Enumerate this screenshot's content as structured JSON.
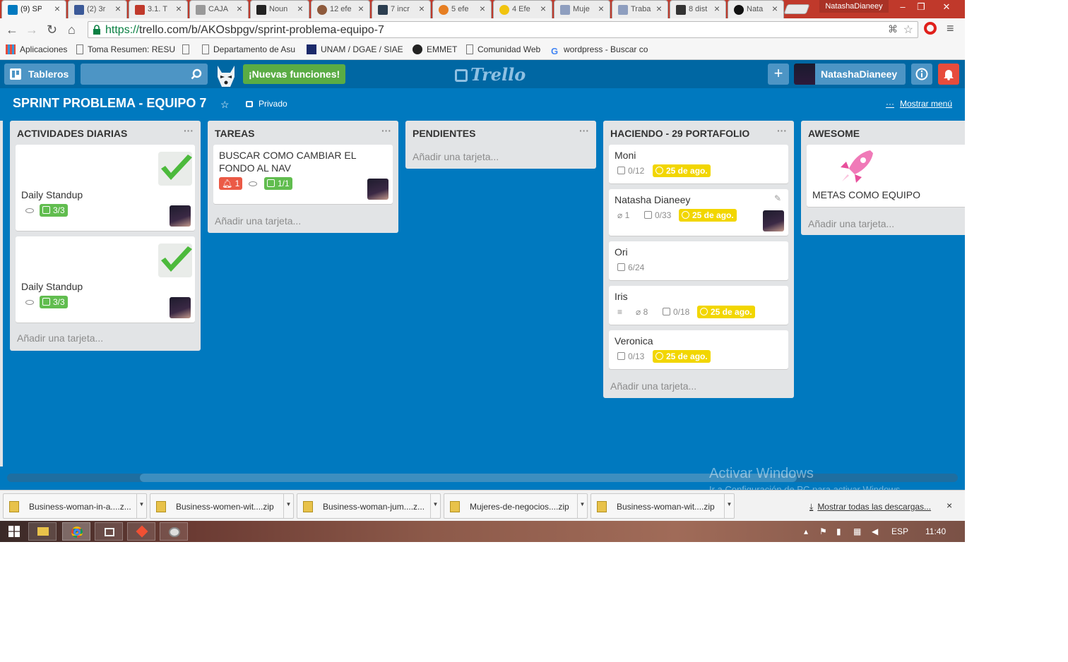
{
  "browser": {
    "tabs": [
      {
        "title": "(9) SP",
        "active": true,
        "icon": "trello-favicon"
      },
      {
        "title": "(2) 3r",
        "icon": "facebook-favicon"
      },
      {
        "title": "3.1. T",
        "icon": "book-favicon"
      },
      {
        "title": "CAJA",
        "icon": "page-favicon"
      },
      {
        "title": "Noun",
        "icon": "noun-favicon"
      },
      {
        "title": "12 efe",
        "icon": "leaf-favicon"
      },
      {
        "title": "7 incr",
        "icon": "mail-favicon"
      },
      {
        "title": "5 efe",
        "icon": "orange-favicon"
      },
      {
        "title": "4 Efe",
        "icon": "yellow-favicon"
      },
      {
        "title": "Muje",
        "icon": "image-favicon"
      },
      {
        "title": "Traba",
        "icon": "image-favicon"
      },
      {
        "title": "8 dist",
        "icon": "e-favicon"
      },
      {
        "title": "Nata",
        "icon": "github-favicon"
      }
    ],
    "window_user": "NatashaDianeey",
    "url_scheme": "https://",
    "url_rest": "trello.com/b/AKOsbpgv/sprint-problema-equipo-7",
    "bookmarks": [
      {
        "label": "Aplicaciones",
        "icon": "apps-icon"
      },
      {
        "label": "Toma Resumen: RESU",
        "icon": "page-icon"
      },
      {
        "label": "",
        "icon": "page-icon"
      },
      {
        "label": "Departamento de Asu",
        "icon": "page-icon"
      },
      {
        "label": "UNAM / DGAE / SIAE",
        "icon": "unam-icon"
      },
      {
        "label": "EMMET",
        "icon": "emmet-icon"
      },
      {
        "label": "Comunidad Web",
        "icon": "page-icon"
      },
      {
        "label": "wordpress - Buscar co",
        "icon": "google-icon"
      }
    ]
  },
  "header": {
    "boards_label": "Tableros",
    "new_features": "¡Nuevas funciones!",
    "logo": "Trello",
    "add": "+",
    "username": "NatashaDianeey",
    "info": "i",
    "notif": "🔔"
  },
  "board": {
    "title": "SPRINT PROBLEMA - EQUIPO 7",
    "privacy": "Privado",
    "show_menu": "Mostrar menú",
    "add_card": "Añadir una tarjeta...",
    "colors": {
      "background": "#0079bf",
      "green": "#61bd4f",
      "red": "#eb5a46",
      "yellow": "#f2d600"
    }
  },
  "lists": [
    {
      "title": "ACTIVIDADES DIARIAS",
      "cards": [
        {
          "title": "Daily Standup",
          "checklist": "3/3"
        },
        {
          "title": "Daily Standup",
          "checklist": "3/3"
        }
      ]
    },
    {
      "title": "TAREAS",
      "cards": [
        {
          "title": "BUSCAR COMO CAMBIAR EL FONDO AL NAV",
          "alerts": "1",
          "checklist": "1/1"
        }
      ]
    },
    {
      "title": "PENDIENTES",
      "cards": []
    },
    {
      "title": "HACIENDO - 29 PORTAFOLIO",
      "cards": [
        {
          "title": "Moni",
          "checklist": "0/12",
          "due": "25 de ago."
        },
        {
          "title": "Natasha Dianeey",
          "attachments": "1",
          "checklist": "0/33",
          "due": "25 de ago."
        },
        {
          "title": "Ori",
          "checklist": "6/24"
        },
        {
          "title": "Iris",
          "attachments": "8",
          "checklist": "0/18",
          "due": "25 de ago."
        },
        {
          "title": "Veronica",
          "checklist": "0/13",
          "due": "25 de ago."
        }
      ]
    },
    {
      "title": "AWESOME",
      "cards": [
        {
          "title": "METAS COMO EQUIPO"
        }
      ]
    }
  ],
  "watermark": {
    "line1": "Activar Windows",
    "line2": "Ir a Configuración de PC para activar Windows."
  },
  "downloads": {
    "items": [
      "Business-woman-in-a....z...",
      "Business-women-wit....zip",
      "Business-woman-jum....z...",
      "Mujeres-de-negocios....zip",
      "Business-woman-wit....zip"
    ],
    "show_all": "Mostrar todas las descargas...",
    "close": "×"
  },
  "taskbar": {
    "lang": "ESP",
    "time": "11:40"
  }
}
